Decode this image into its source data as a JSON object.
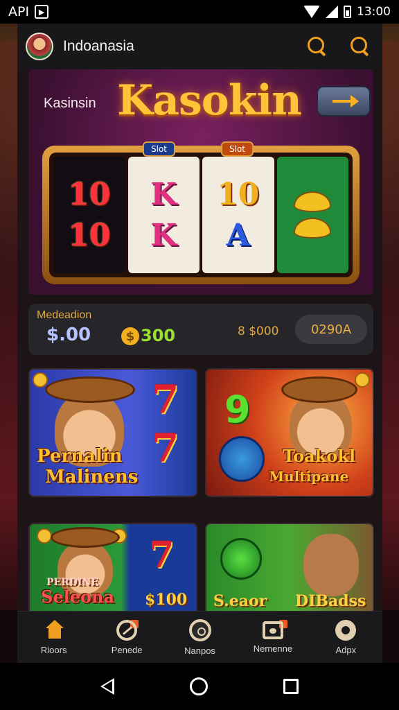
{
  "status_bar": {
    "left_text": "API",
    "time": "13:00"
  },
  "header": {
    "title": "Indoanasia"
  },
  "hero": {
    "subtitle": "Kasinsin",
    "title": "Kasokin",
    "reel_badge_left": "Slot",
    "reel_badge_right": "Slot",
    "reels": [
      {
        "top": "10",
        "bottom": "10"
      },
      {
        "top": "K",
        "bottom": "K"
      },
      {
        "top": "10",
        "bottom": "A"
      }
    ]
  },
  "balance": {
    "label": "Medeadion",
    "amount": "$.00",
    "coin_symbol": "$",
    "coins": "300",
    "mid_value": "8 $000",
    "pill_value": "0290A"
  },
  "cards": [
    {
      "title_line1": "Pernalin",
      "title_line2": "Malinens",
      "seven_top": "7",
      "seven_bottom": "7"
    },
    {
      "nine": "9",
      "title_line1": "Toakokl",
      "title_line2": "Multipane"
    },
    {
      "title": "Seleona",
      "banner": "PERDINE",
      "seven": "7",
      "price": "$100"
    },
    {
      "left_text": "S.eaor",
      "right_text": "DIBadss"
    }
  ],
  "tabs": [
    {
      "label": "Rioors",
      "icon": "home-icon"
    },
    {
      "label": "Penede",
      "icon": "sports-ball-icon"
    },
    {
      "label": "Nanpos",
      "icon": "casino-chip-icon"
    },
    {
      "label": "Nemenne",
      "icon": "message-icon"
    },
    {
      "label": "Adpx",
      "icon": "gear-icon"
    }
  ],
  "colors": {
    "accent": "#f0a020",
    "background": "#1d1418"
  }
}
